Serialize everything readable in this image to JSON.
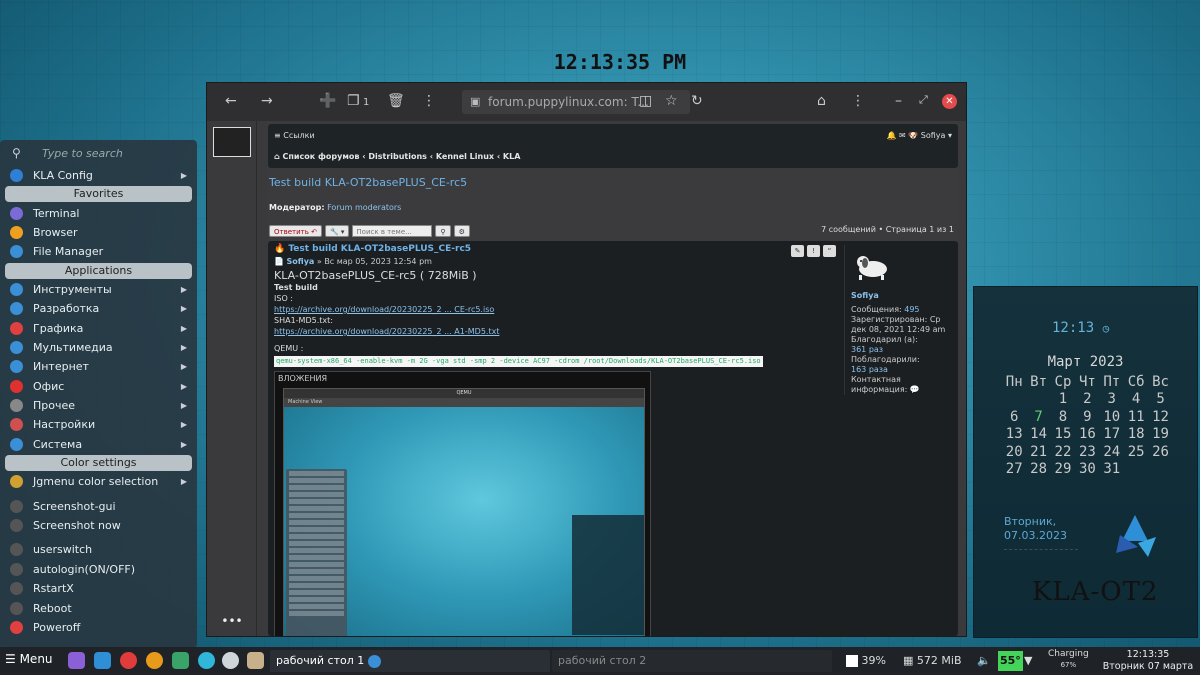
{
  "desktop": {
    "clock": "12:13:35 PM"
  },
  "menu": {
    "search_placeholder": "Type to search",
    "items": [
      {
        "label": "KLA Config",
        "arrow": true,
        "color": "#2f7fd6"
      },
      {
        "section": "Favorites"
      },
      {
        "label": "Terminal",
        "color": "#7b6bd6"
      },
      {
        "label": "Browser",
        "color": "#f0a020"
      },
      {
        "label": "File Manager",
        "color": "#3a8fd6"
      },
      {
        "section": "Applications"
      },
      {
        "label": "Инструменты",
        "arrow": true,
        "color": "#3a8fd6"
      },
      {
        "label": "Разработка",
        "arrow": true,
        "color": "#3a8fd6"
      },
      {
        "label": "Графика",
        "arrow": true,
        "color": "#e04040"
      },
      {
        "label": "Мультимедиа",
        "arrow": true,
        "color": "#3a8fd6"
      },
      {
        "label": "Интернет",
        "arrow": true,
        "color": "#3a8fd6"
      },
      {
        "label": "Офис",
        "arrow": true,
        "color": "#e03030"
      },
      {
        "label": "Прочее",
        "arrow": true,
        "color": "#888"
      },
      {
        "label": "Настройки",
        "arrow": true,
        "color": "#d05050"
      },
      {
        "label": "Система",
        "arrow": true,
        "color": "#3a8fd6"
      },
      {
        "section": "Color settings"
      },
      {
        "label": "Jgmenu color selection",
        "arrow": true,
        "color": "#d0a030"
      },
      {
        "sep": true
      },
      {
        "label": "Screenshot-gui",
        "color": "#555"
      },
      {
        "label": "Screenshot now",
        "color": "#555"
      },
      {
        "sep": true
      },
      {
        "label": "userswitch",
        "color": "#555"
      },
      {
        "label": "autologin(ON/OFF)",
        "color": "#555"
      },
      {
        "label": "RstartX",
        "color": "#555"
      },
      {
        "label": "Reboot",
        "color": "#555"
      },
      {
        "label": "Poweroff",
        "color": "#e04040"
      }
    ]
  },
  "browser": {
    "url": "forum.puppylinux.com: T...",
    "tab_count": "1",
    "nav": {
      "links_label": "Ссылки",
      "user": "Sofiya",
      "breadcrumb": [
        "Список форумов",
        "Distributions",
        "Kennel Linux",
        "KLA"
      ]
    },
    "topic_title": "Test build KLA-OT2basePLUS_CE-rc5",
    "moderator_label": "Модератор:",
    "moderator_value": "Forum moderators",
    "reply_label": "Ответить",
    "search_placeholder": "Поиск в теме...",
    "pagination": "7 сообщений • Страница 1 из 1",
    "post": {
      "title": "Test build KLA-OT2basePLUS_CE-rc5",
      "author": "Sofiya",
      "date": "» Вс мар 05, 2023 12:54 pm",
      "headline": "KLA-OT2basePLUS_CE-rc5 ( 728MiB )",
      "bold_line": "Test build",
      "iso_label": "ISO :",
      "iso_link": "https://archive.org/download/20230225_2 ... CE-rc5.iso",
      "sha_label": "SHA1-MD5.txt:",
      "sha_link": "https://archive.org/download/20230225_2 ... A1-MD5.txt",
      "qemu_label": "QEMU :",
      "qemu_cmd": "qemu-system-x86_64 -enable-kvm -m 2G -vga std -smp 2 -device AC97 -cdrom /root/Downloads/KLA-OT2basePLUS_CE-rc5.iso",
      "attachment_caption": "ВЛОЖЕНИЯ",
      "qemu_title": "QEMU",
      "qemu_menu": "Machine   View"
    },
    "author_info": {
      "name": "Sofiya",
      "messages_label": "Сообщения:",
      "messages": "495",
      "registered": "Зарегистрирован: Ср дек 08, 2021 12:49 am",
      "thanked_label": "Благодарил (а):",
      "thanked": "361 раз",
      "thanks_label": "Поблагодарили:",
      "thanks": "163 раза",
      "contact": "Контактная информация:"
    }
  },
  "widget": {
    "time": "12:13",
    "month": "Март 2023",
    "weekdays": [
      "Пн",
      "Вт",
      "Ср",
      "Чт",
      "Пт",
      "Сб",
      "Вс"
    ],
    "weeks": [
      [
        "",
        "",
        "1",
        "2",
        "3",
        "4",
        "5"
      ],
      [
        "6",
        "7",
        "8",
        "9",
        "10",
        "11",
        "12"
      ],
      [
        "13",
        "14",
        "15",
        "16",
        "17",
        "18",
        "19"
      ],
      [
        "20",
        "21",
        "22",
        "23",
        "24",
        "25",
        "26"
      ],
      [
        "27",
        "28",
        "29",
        "30",
        "31",
        "",
        ""
      ]
    ],
    "today": "7",
    "day_line1": "Вторник,",
    "day_line2": "07.03.2023",
    "logo": "KLA-OT2"
  },
  "taskbar": {
    "menu_label": "Menu",
    "task1": "рабочий стол 1",
    "task2": "рабочий стол 2",
    "battery_pct": "39%",
    "mem": "572 MiB",
    "temp": "55°",
    "charging": "Charging",
    "charging_pct": "67%",
    "clock_time": "12:13:35",
    "clock_date": "Вторник 07 марта"
  }
}
